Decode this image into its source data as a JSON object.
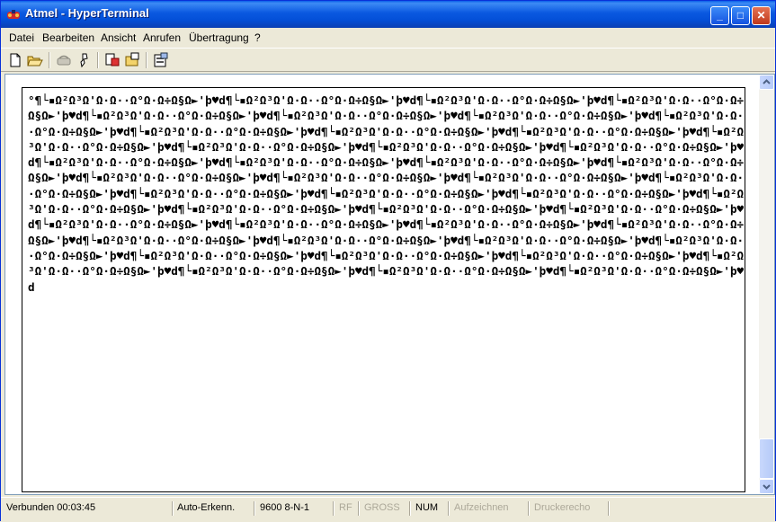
{
  "window": {
    "title": "Atmel - HyperTerminal"
  },
  "title_buttons": {
    "minimize": "_",
    "maximize": "□",
    "close": "✕"
  },
  "menu": [
    "Datei",
    "Bearbeiten",
    "Ansicht",
    "Anrufen",
    "Übertragung",
    "?"
  ],
  "toolbar": {
    "icons": [
      "new-icon",
      "open-icon",
      "connect-icon",
      "disconnect-icon",
      "send-icon",
      "receive-icon",
      "properties-icon"
    ]
  },
  "terminal": {
    "text": "°¶└▪Ω²Ω³Ω'Ω·Ω··Ω°Ω·Ω÷Ω§Ω►'þ♥d¶└▪Ω²Ω³Ω'Ω·Ω··Ω°Ω·Ω÷Ω§Ω►'þ♥d¶└▪Ω²Ω³Ω'Ω·Ω··Ω°Ω·Ω÷Ω§Ω►'þ♥d¶└▪Ω²Ω³Ω'Ω·Ω··Ω°Ω·Ω÷Ω§Ω►'þ♥d¶└▪Ω²Ω³Ω'Ω·Ω··Ω°Ω·Ω÷Ω§Ω►'þ♥d¶└▪Ω²Ω³Ω'Ω·Ω··Ω°Ω·Ω÷Ω§Ω►'þ♥d¶└▪Ω²Ω³Ω'Ω·Ω··Ω°Ω·Ω÷Ω§Ω►'þ♥d¶└▪Ω²Ω³Ω'Ω·Ω··Ω°Ω·Ω÷Ω§Ω►'þ♥d¶└▪Ω²Ω³Ω'Ω·Ω··Ω°Ω·Ω÷Ω§Ω►'þ♥d¶└▪Ω²Ω³Ω'Ω·Ω··Ω°Ω·Ω÷Ω§Ω►'þ♥d¶└▪Ω²Ω³Ω'Ω·Ω··Ω°Ω·Ω÷Ω§Ω►'þ♥d¶└▪Ω²Ω³Ω'Ω·Ω··Ω°Ω·Ω÷Ω§Ω►'þ♥d¶└▪Ω²Ω³Ω'Ω·Ω··Ω°Ω·Ω÷Ω§Ω►'þ♥d¶└▪Ω²Ω³Ω'Ω·Ω··Ω°Ω·Ω÷Ω§Ω►'þ♥d¶└▪Ω²Ω³Ω'Ω·Ω··Ω°Ω·Ω÷Ω§Ω►'þ♥d¶└▪Ω²Ω³Ω'Ω·Ω··Ω°Ω·Ω÷Ω§Ω►'þ♥d¶└▪Ω²Ω³Ω'Ω·Ω··Ω°Ω·Ω÷Ω§Ω►'þ♥d¶└▪Ω²Ω³Ω'Ω·Ω··Ω°Ω·Ω÷Ω§Ω►'þ♥d¶└▪Ω²Ω³Ω'Ω·Ω··Ω°Ω·Ω÷Ω§Ω►'þ♥d¶└▪Ω²Ω³Ω'Ω·Ω··Ω°Ω·Ω÷Ω§Ω►'þ♥d¶└▪Ω²Ω³Ω'Ω·Ω··Ω°Ω·Ω÷Ω§Ω►'þ♥d¶└▪Ω²Ω³Ω'Ω·Ω··Ω°Ω·Ω÷Ω§Ω►'þ♥d¶└▪Ω²Ω³Ω'Ω·Ω··Ω°Ω·Ω÷Ω§Ω►'þ♥d¶└▪Ω²Ω³Ω'Ω·Ω··Ω°Ω·Ω÷Ω§Ω►'þ♥d¶└▪Ω²Ω³Ω'Ω·Ω··Ω°Ω·Ω÷Ω§Ω►'þ♥d¶└▪Ω²Ω³Ω'Ω·Ω··Ω°Ω·Ω÷Ω§Ω►'þ♥d¶└▪Ω²Ω³Ω'Ω·Ω··Ω°Ω·Ω÷Ω§Ω►'þ♥d¶└▪Ω²Ω³Ω'Ω·Ω··Ω°Ω·Ω÷Ω§Ω►'þ♥d¶└▪Ω²Ω³Ω'Ω·Ω··Ω°Ω·Ω÷Ω§Ω►'þ♥d¶└▪Ω²Ω³Ω'Ω·Ω··Ω°Ω·Ω÷Ω§Ω►'þ♥d¶└▪Ω²Ω³Ω'Ω·Ω··Ω°Ω·Ω÷Ω§Ω►'þ♥d¶└▪Ω²Ω³Ω'Ω·Ω··Ω°Ω·Ω÷Ω§Ω►'þ♥d¶└▪Ω²Ω³Ω'Ω·Ω··Ω°Ω·Ω÷Ω§Ω►'þ♥d¶└▪Ω²Ω³Ω'Ω·Ω··Ω°Ω·Ω÷Ω§Ω►'þ♥d¶└▪Ω²Ω³Ω'Ω·Ω··Ω°Ω·Ω÷Ω§Ω►'þ♥d¶└▪Ω²Ω³Ω'Ω·Ω··Ω°Ω·Ω÷Ω§Ω►'þ♥d¶└▪Ω²Ω³Ω'Ω·Ω··Ω°Ω·Ω÷Ω§Ω►'þ♥d¶└▪Ω²Ω³Ω'Ω·Ω··Ω°Ω·Ω÷Ω§Ω►'þ♥d¶└▪Ω²Ω³Ω'Ω·Ω··Ω°Ω·Ω÷Ω§Ω►'þ♥d¶└▪Ω²Ω³Ω'Ω·Ω··Ω°Ω·Ω÷Ω§Ω►'þ♥d¶└▪Ω²Ω³Ω'Ω·Ω··Ω°Ω·Ω÷Ω§Ω►'þ♥d¶└▪Ω²Ω³Ω'Ω·Ω··Ω°Ω·Ω÷Ω§Ω►'þ♥d¶└▪Ω²Ω³Ω'Ω·Ω··Ω°Ω·Ω÷Ω§Ω►'þ♥d¶└▪Ω²Ω³Ω'Ω·Ω··Ω°Ω·Ω÷Ω§Ω►'þ♥d¶└▪Ω²Ω³Ω'Ω·Ω··Ω°Ω·Ω÷Ω§Ω►'þ♥d"
  },
  "status": {
    "connection": "Verbunden 00:03:45",
    "detect": "Auto-Erkenn.",
    "settings": "9600 8-N-1",
    "rf": "RF",
    "caps": "GROSS",
    "num": "NUM",
    "capture": "Aufzeichnen",
    "print": "Druckerecho"
  },
  "colors": {
    "titlebar": "#0A5FE8",
    "chrome": "#ECE9D8",
    "close": "#C0391C"
  }
}
